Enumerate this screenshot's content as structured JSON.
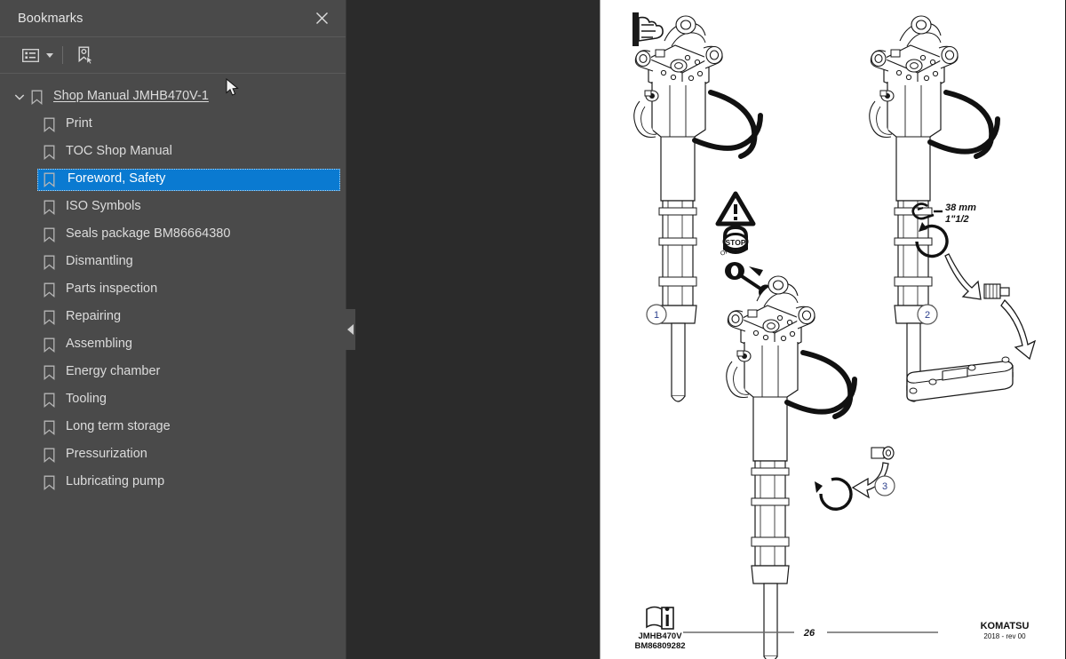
{
  "panel": {
    "title": "Bookmarks",
    "close_icon": "close-icon",
    "toolbar": {
      "options_icon": "list-options-icon",
      "options_caret_icon": "chevron-down-icon",
      "new_bookmark_icon": "new-bookmark-icon"
    },
    "collapse_icon": "collapse-left-icon",
    "tree": {
      "root": {
        "label": "Shop Manual  JMHB470V-1",
        "expanded": true,
        "twisty_icon": "chevron-down-icon",
        "bookmark_icon": "bookmark-icon"
      },
      "items": [
        {
          "label": "Print",
          "selected": false,
          "bookmark_icon": "bookmark-icon"
        },
        {
          "label": "TOC Shop Manual",
          "selected": false,
          "bookmark_icon": "bookmark-icon"
        },
        {
          "label": "Foreword, Safety",
          "selected": true,
          "bookmark_icon": "bookmark-icon"
        },
        {
          "label": "ISO Symbols",
          "selected": false,
          "bookmark_icon": "bookmark-icon"
        },
        {
          "label": "Seals package BM86664380",
          "selected": false,
          "bookmark_icon": "bookmark-icon"
        },
        {
          "label": "Dismantling",
          "selected": false,
          "bookmark_icon": "bookmark-icon"
        },
        {
          "label": "Parts inspection",
          "selected": false,
          "bookmark_icon": "bookmark-icon"
        },
        {
          "label": "Repairing",
          "selected": false,
          "bookmark_icon": "bookmark-icon"
        },
        {
          "label": "Assembling",
          "selected": false,
          "bookmark_icon": "bookmark-icon"
        },
        {
          "label": "Energy chamber",
          "selected": false,
          "bookmark_icon": "bookmark-icon"
        },
        {
          "label": "Tooling",
          "selected": false,
          "bookmark_icon": "bookmark-icon"
        },
        {
          "label": "Long term storage",
          "selected": false,
          "bookmark_icon": "bookmark-icon"
        },
        {
          "label": "Pressurization",
          "selected": false,
          "bookmark_icon": "bookmark-icon"
        },
        {
          "label": "Lubricating pump",
          "selected": false,
          "bookmark_icon": "bookmark-icon"
        }
      ]
    }
  },
  "document_page": {
    "corner_icon": "hand-pointing-icon",
    "callouts": [
      "1",
      "2",
      "3"
    ],
    "annotations": {
      "wrench_size_metric": "38 mm",
      "wrench_size_imperial": "1\"1/2",
      "wrench_icon": "wrench-icon",
      "warning_icon": "warning-triangle-icon",
      "stop_engine_icon": "stop-engine-icon",
      "key_off_icon": "key-off-icon",
      "key_off_label": "OFF"
    },
    "footer": {
      "book_icon": "manual-book-icon",
      "model": "JMHB470V",
      "part_number": "BM86809282",
      "page_number": "26",
      "brand": "KOMATSU",
      "revision": "2018 -  rev 00"
    }
  },
  "colors": {
    "panel_bg": "#4a4a4a",
    "viewer_bg": "#2b2b2b",
    "selection_blue": "#0a7ad1",
    "text": "#dcdcdc",
    "page_white": "#ffffff",
    "callout_blue": "#2b3f8c"
  }
}
